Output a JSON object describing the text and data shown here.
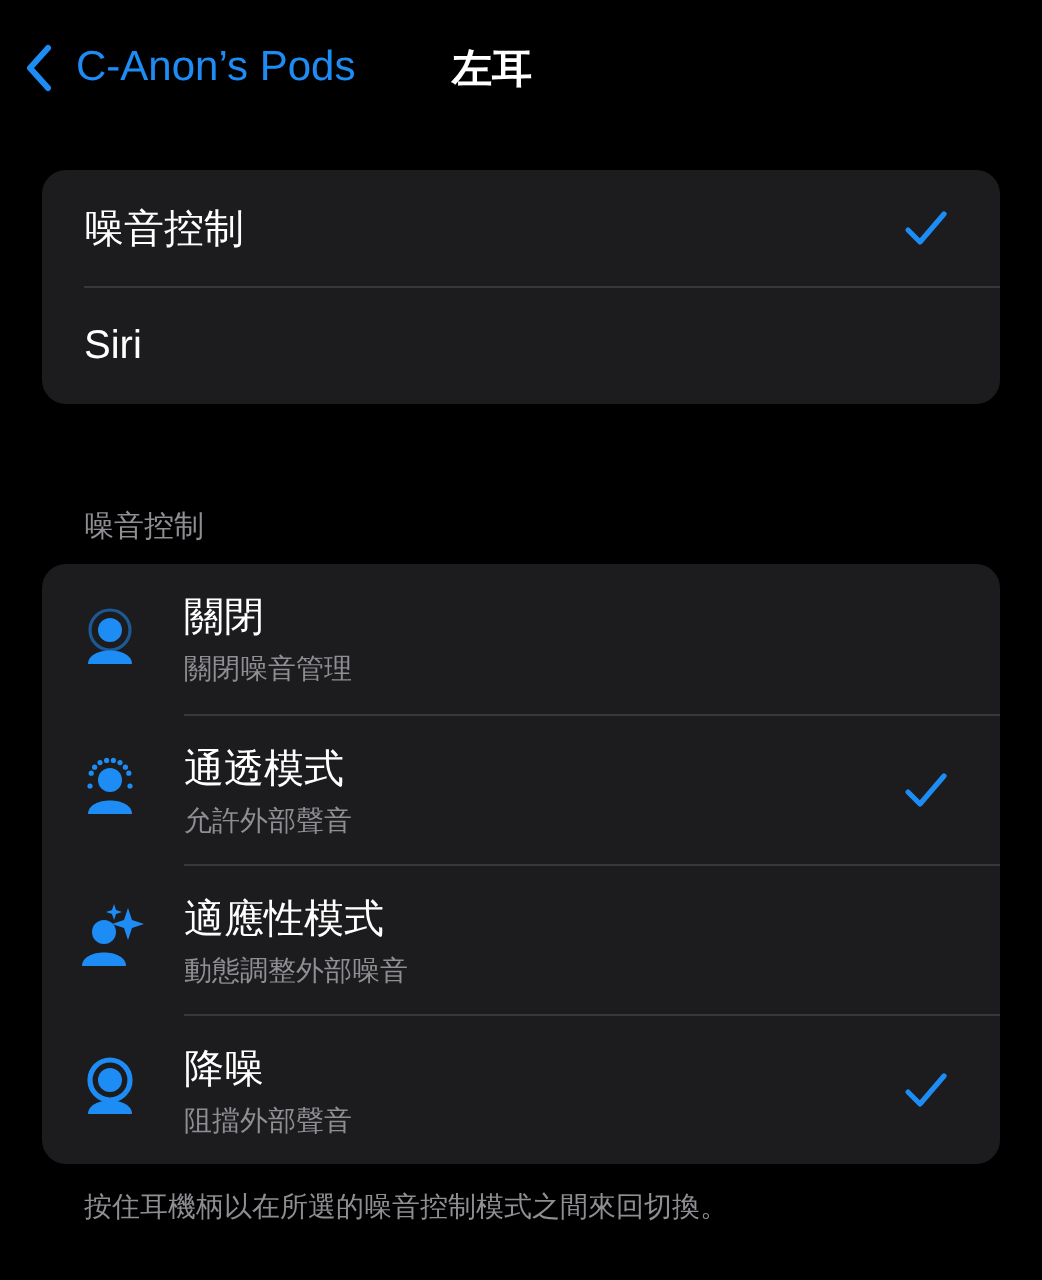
{
  "nav": {
    "back": "C-Anon’s Pods",
    "title": "左耳"
  },
  "press_action": [
    {
      "label": "噪音控制",
      "selected": true
    },
    {
      "label": "Siri",
      "selected": false
    }
  ],
  "noise_control": {
    "header": "噪音控制",
    "modes": [
      {
        "kind": "off",
        "title": "關閉",
        "subtitle": "關閉噪音管理",
        "selected": false
      },
      {
        "kind": "transparency",
        "title": "通透模式",
        "subtitle": "允許外部聲音",
        "selected": true
      },
      {
        "kind": "adaptive",
        "title": "適應性模式",
        "subtitle": "動態調整外部噪音",
        "selected": false
      },
      {
        "kind": "cancellation",
        "title": "降噪",
        "subtitle": "阻擋外部聲音",
        "selected": true
      }
    ],
    "footer": "按住耳機柄以在所選的噪音控制模式之間來回切換。"
  }
}
